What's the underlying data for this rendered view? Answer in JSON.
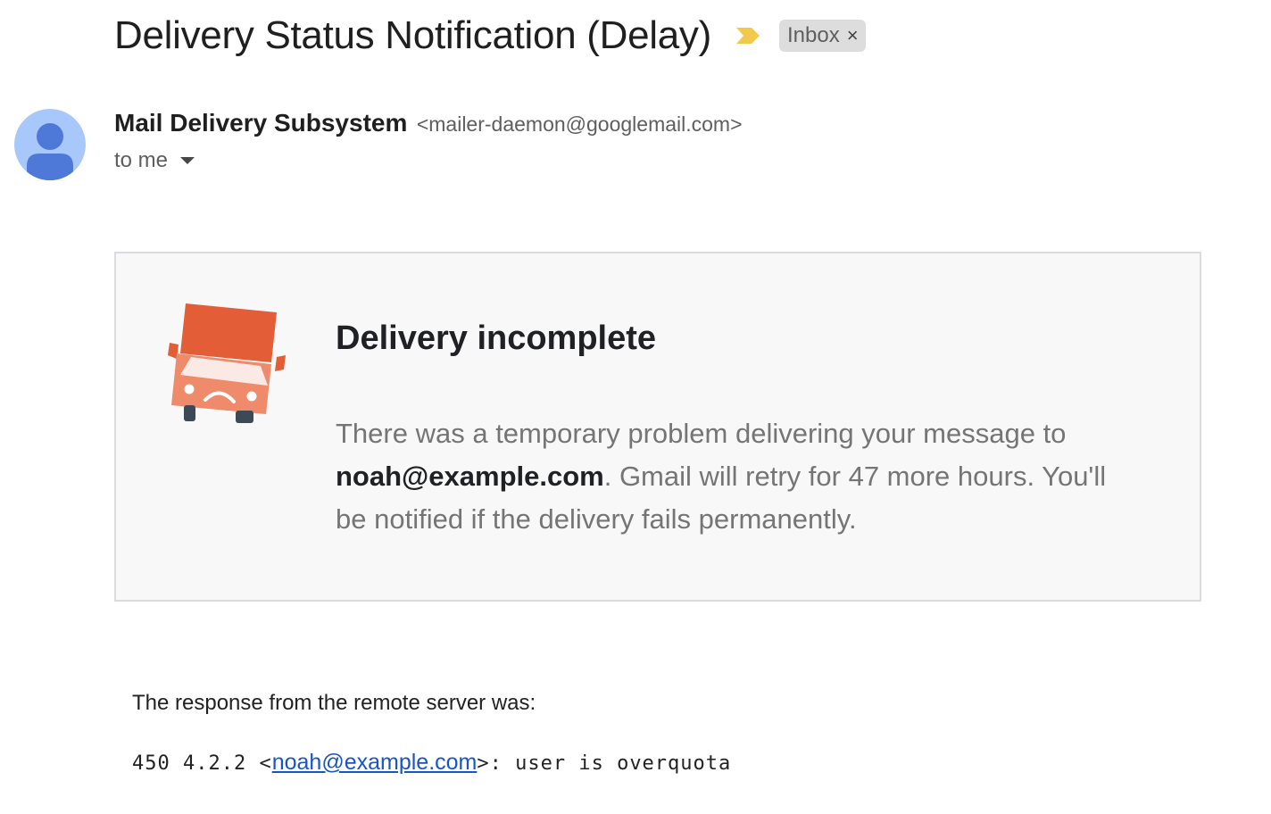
{
  "email": {
    "subject": "Delivery Status Notification (Delay)",
    "label": "Inbox",
    "label_remove": "×",
    "importance_color": "#f2c94c",
    "sender": {
      "name": "Mail Delivery Subsystem",
      "email": "<mailer-daemon@googlemail.com>"
    },
    "recipient_label": "to me"
  },
  "card": {
    "title": "Delivery incomplete",
    "body_prefix": "There was a temporary problem delivering your message to ",
    "recipient": "noah@example.com",
    "body_suffix": ". Gmail will retry for 47 more hours. You'll be notified if the delivery fails permanently.",
    "icon": "sad-truck-icon"
  },
  "response": {
    "label": "The response from the remote server was:",
    "code_prefix": "450 4.2.2 <",
    "address": "noah@example.com",
    "code_suffix": ">: user is overquota"
  },
  "colors": {
    "truck_dark": "#e35d36",
    "truck_light": "#ef8a6a",
    "avatar_bg": "#a8c7fa",
    "avatar_fg": "#4e79d8",
    "link": "#1a55c5"
  }
}
